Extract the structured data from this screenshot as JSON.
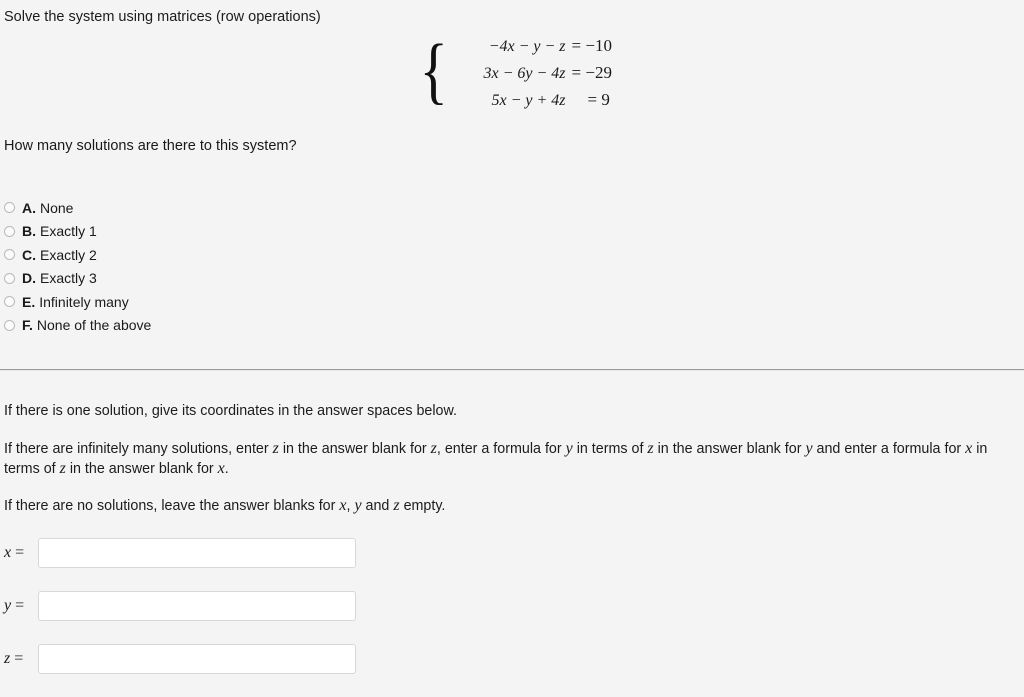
{
  "prompt": {
    "title": "Solve the system using matrices (row operations)",
    "question": "How many solutions are there to this system?"
  },
  "system": {
    "brace": "{",
    "equations": [
      {
        "lhs": "−4x − y − z",
        "rhs": "= −10"
      },
      {
        "lhs": "3x − 6y − 4z",
        "rhs": "= −29"
      },
      {
        "lhs": "5x − y + 4z",
        "rhs": "= 9"
      }
    ]
  },
  "options": [
    {
      "letter": "A.",
      "label": "None",
      "selected": false
    },
    {
      "letter": "B.",
      "label": "Exactly 1",
      "selected": false
    },
    {
      "letter": "C.",
      "label": "Exactly 2",
      "selected": false
    },
    {
      "letter": "D.",
      "label": "Exactly 3",
      "selected": false
    },
    {
      "letter": "E.",
      "label": "Infinitely many",
      "selected": false
    },
    {
      "letter": "F.",
      "label": "None of the above",
      "selected": false
    }
  ],
  "instructions": {
    "p1": "If there is one solution, give its coordinates in the answer spaces below.",
    "p2_a": "If there are infinitely many solutions, enter ",
    "p2_v1": "z",
    "p2_b": " in the answer blank for ",
    "p2_v2": "z",
    "p2_c": ", enter a formula for ",
    "p2_v3": "y",
    "p2_d": " in terms of ",
    "p2_v4": "z",
    "p2_e": " in the answer blank for ",
    "p2_v5": "y",
    "p2_f": " and enter a formula for ",
    "p2_v6": "x",
    "p2_g": " in terms of ",
    "p2_v7": "z",
    "p2_h": " in the answer blank for ",
    "p2_v8": "x",
    "p2_i": ".",
    "p3_a": "If there are no solutions, leave the answer blanks for ",
    "p3_v1": "x",
    "p3_b": ", ",
    "p3_v2": "y",
    "p3_c": " and ",
    "p3_v3": "z",
    "p3_d": " empty."
  },
  "answers": [
    {
      "name": "x",
      "var": "x",
      "equals": " =",
      "value": "",
      "placeholder": ""
    },
    {
      "name": "y",
      "var": "y",
      "equals": " =",
      "value": "",
      "placeholder": ""
    },
    {
      "name": "z",
      "var": "z",
      "equals": " =",
      "value": "",
      "placeholder": ""
    }
  ],
  "colors": {
    "background": "#f4f4f4",
    "text": "#1c1c1c",
    "divider": "#9a9a9a",
    "input_border": "#d8d8d8",
    "input_background": "#ffffff",
    "radio_border": "#b9b9b9"
  }
}
